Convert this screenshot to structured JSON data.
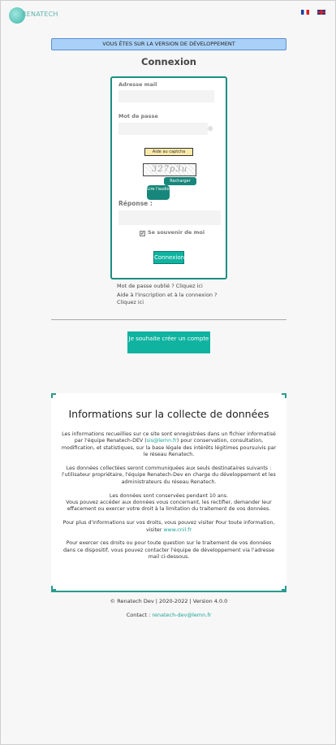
{
  "header": {
    "logo_text": "RENATECH",
    "lang_fr": "FR",
    "lang_en": "EN"
  },
  "banner": "VOUS ÊTES SUR LA VERSION DE DÉVELOPPEMENT",
  "page_title": "Connexion",
  "login": {
    "email_label": "Adresse mail",
    "password_label": "Mot de passe",
    "captcha_help": "Aide au captcha",
    "captcha_text": "327p3u",
    "reload_label": "Recharger",
    "listen_label": "Lire l'audio",
    "answer_label": "Réponse :",
    "remember_label": "Se souvenir de moi",
    "submit_label": "Connexion"
  },
  "links": {
    "forgot_password": "Mot de passe oublié ? Cliquez ici",
    "help_line1": "Aide à l'inscription et à la connexion ?",
    "help_line2": "Cliquez ici"
  },
  "create_account": "Je souhaite créer un compte",
  "info": {
    "title": "Informations sur la collecte de données",
    "p1_a": "Les informations recueillies sur ce site sont enregistrées dans un fichier informatisé par l'équipe Renatech-DEV (",
    "p1_link": "sis@lemn.fr",
    "p1_b": ") pour conservation, consultation, modification, et statistiques, sur la base légale des intérêts légitimes poursuivis par le réseau Renatech.",
    "p2": "Les données collectées seront communiquées aux seuls destinataires suivants : l'utilisateur propriétaire, l'équipe Renatech-Dev en charge du développement et les administrateurs du réseau Renatech.",
    "p3": "Les données sont conservées pendant 10 ans.",
    "p4": "Vous pouvez accéder aux données vous concernant, les rectifier, demander leur effacement ou exercer votre droit à la limitation du traitement de vos données.",
    "p5_a": "Pour plus d'informations sur vos droits, vous pouvez visiter Pour toute information, visiter ",
    "p5_link": "www.cnil.fr",
    "p6": "Pour exercer ces droits ou pour toute question sur le traitement de vos données dans ce dispositif, vous pouvez contacter l'équipe de développement via l'adresse mail ci-dessous."
  },
  "footer": {
    "copyright": "© Renatech Dev | 2020-2022 | Version 4.0.0",
    "contact_label": "Contact : ",
    "contact_email": "renatech-dev@lemn.fr"
  },
  "colors": {
    "accent": "#0fb3a0",
    "border": "#1b8f83",
    "banner_bg": "#a9d1f7"
  }
}
